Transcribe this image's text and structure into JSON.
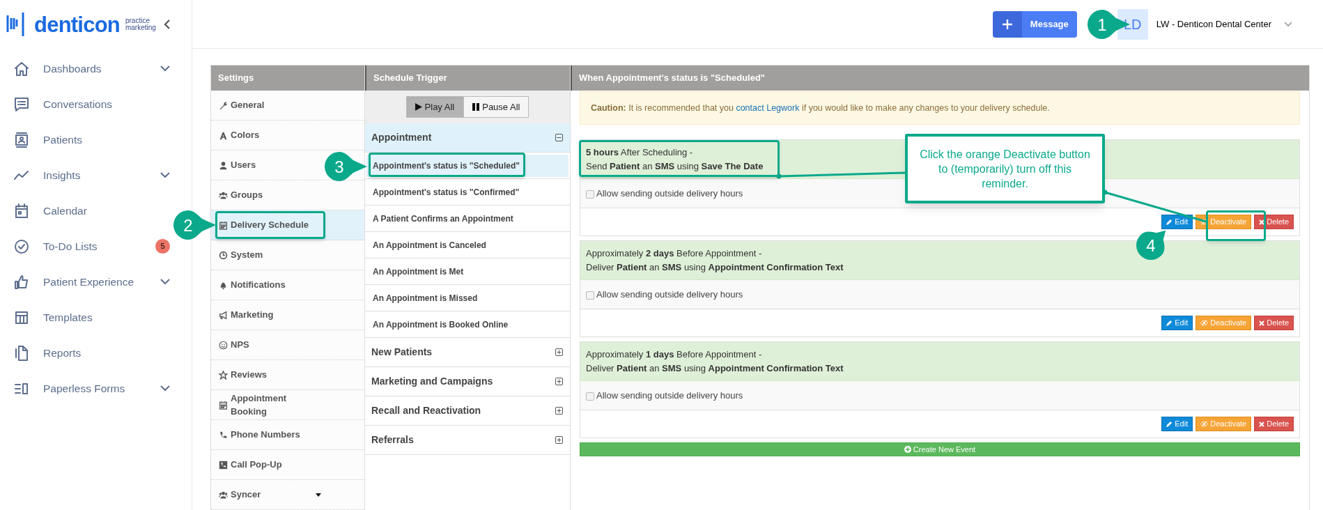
{
  "sidebar": {
    "logo": {
      "word": "denticon",
      "tagline": [
        "practice",
        "marketing"
      ]
    },
    "nav": [
      {
        "label": "Dashboards",
        "expandable": true
      },
      {
        "label": "Conversations",
        "expandable": false
      },
      {
        "label": "Patients",
        "expandable": false
      },
      {
        "label": "Insights",
        "expandable": true
      },
      {
        "label": "Calendar",
        "expandable": false
      },
      {
        "label": "To-Do Lists",
        "expandable": false,
        "badge": "5"
      },
      {
        "label": "Patient Experience",
        "expandable": true
      },
      {
        "label": "Templates",
        "expandable": false
      },
      {
        "label": "Reports",
        "expandable": false
      },
      {
        "label": "Paperless Forms",
        "expandable": true
      }
    ]
  },
  "header": {
    "message_button": "Message",
    "avatar": "LD",
    "account": "LW - Denticon Dental Center"
  },
  "settings": {
    "title": "Settings",
    "items": [
      {
        "label": "General",
        "selected": false,
        "dropdown": false
      },
      {
        "label": "Colors",
        "selected": false,
        "dropdown": false
      },
      {
        "label": "Users",
        "selected": false,
        "dropdown": false
      },
      {
        "label": "Groups",
        "selected": false,
        "dropdown": false
      },
      {
        "label": "Delivery Schedule",
        "selected": true,
        "dropdown": false
      },
      {
        "label": "System",
        "selected": false,
        "dropdown": false
      },
      {
        "label": "Notifications",
        "selected": false,
        "dropdown": false
      },
      {
        "label": "Marketing",
        "selected": false,
        "dropdown": false
      },
      {
        "label": "NPS",
        "selected": false,
        "dropdown": false
      },
      {
        "label": "Reviews",
        "selected": false,
        "dropdown": false
      },
      {
        "label": "Appointment Booking",
        "selected": false,
        "dropdown": false
      },
      {
        "label": "Phone Numbers",
        "selected": false,
        "dropdown": false
      },
      {
        "label": "Call Pop-Up",
        "selected": false,
        "dropdown": false
      },
      {
        "label": "Syncer",
        "selected": false,
        "dropdown": true
      }
    ]
  },
  "trigger": {
    "title": "Schedule Trigger",
    "buttons": [
      {
        "label": "Play All",
        "kind": "play",
        "selected": true
      },
      {
        "label": "Pause All",
        "kind": "pause",
        "selected": false
      }
    ],
    "groups": [
      {
        "label": "Appointment",
        "expanded": true,
        "items": [
          {
            "label": "Appointment's status is \"Scheduled\"",
            "selected": true
          },
          {
            "label": "Appointment's status is \"Confirmed\"",
            "selected": false
          },
          {
            "label": "A Patient Confirms an Appointment",
            "selected": false
          },
          {
            "label": "An Appointment is Canceled",
            "selected": false
          },
          {
            "label": "An Appointment is Met",
            "selected": false
          },
          {
            "label": "An Appointment is Missed",
            "selected": false
          },
          {
            "label": "An Appointment is Booked Online",
            "selected": false
          }
        ]
      },
      {
        "label": "New Patients",
        "expanded": false
      },
      {
        "label": "Marketing and Campaigns",
        "expanded": false
      },
      {
        "label": "Recall and Reactivation",
        "expanded": false
      },
      {
        "label": "Referrals",
        "expanded": false
      }
    ]
  },
  "panel": {
    "title": "When Appointment's status is \"Scheduled\"",
    "caution": {
      "lead": "Caution:",
      "before": "It is recommended that you",
      "link": "contact Legwork",
      "after": "if you would like to make any changes to your delivery schedule."
    },
    "events": [
      {
        "lines": [
          "**5 hours** After Scheduling -",
          "Send **Patient** an **SMS** using **Save The Date**"
        ],
        "option": {
          "label": "Allow sending outside delivery hours",
          "checked": false
        },
        "buttons": [
          {
            "kind": "edit",
            "label": "Edit"
          },
          {
            "kind": "deactivate",
            "label": "Deactivate"
          },
          {
            "kind": "delete",
            "label": "Delete"
          }
        ]
      },
      {
        "lines": [
          "Approximately **2 days** Before Appointment -",
          "Deliver **Patient** an **SMS** using **Appointment Confirmation Text**"
        ],
        "option": {
          "label": "Allow sending outside delivery hours",
          "checked": false
        },
        "buttons": [
          {
            "kind": "edit",
            "label": "Edit"
          },
          {
            "kind": "deactivate",
            "label": "Deactivate"
          },
          {
            "kind": "delete",
            "label": "Delete"
          }
        ]
      },
      {
        "lines": [
          "Approximately **1 days** Before Appointment -",
          "Deliver **Patient** an **SMS** using **Appointment Confirmation Text**"
        ],
        "option": {
          "label": "Allow sending outside delivery hours",
          "checked": false
        },
        "buttons": [
          {
            "kind": "edit",
            "label": "Edit"
          },
          {
            "kind": "deactivate",
            "label": "Deactivate"
          },
          {
            "kind": "delete",
            "label": "Delete"
          }
        ]
      }
    ],
    "create_button": "Create New Event"
  },
  "annotations": {
    "steps": [
      "1",
      "2",
      "3",
      "4"
    ],
    "callout": "Click the orange Deactivate button to (temporarily) turn off this reminder."
  }
}
